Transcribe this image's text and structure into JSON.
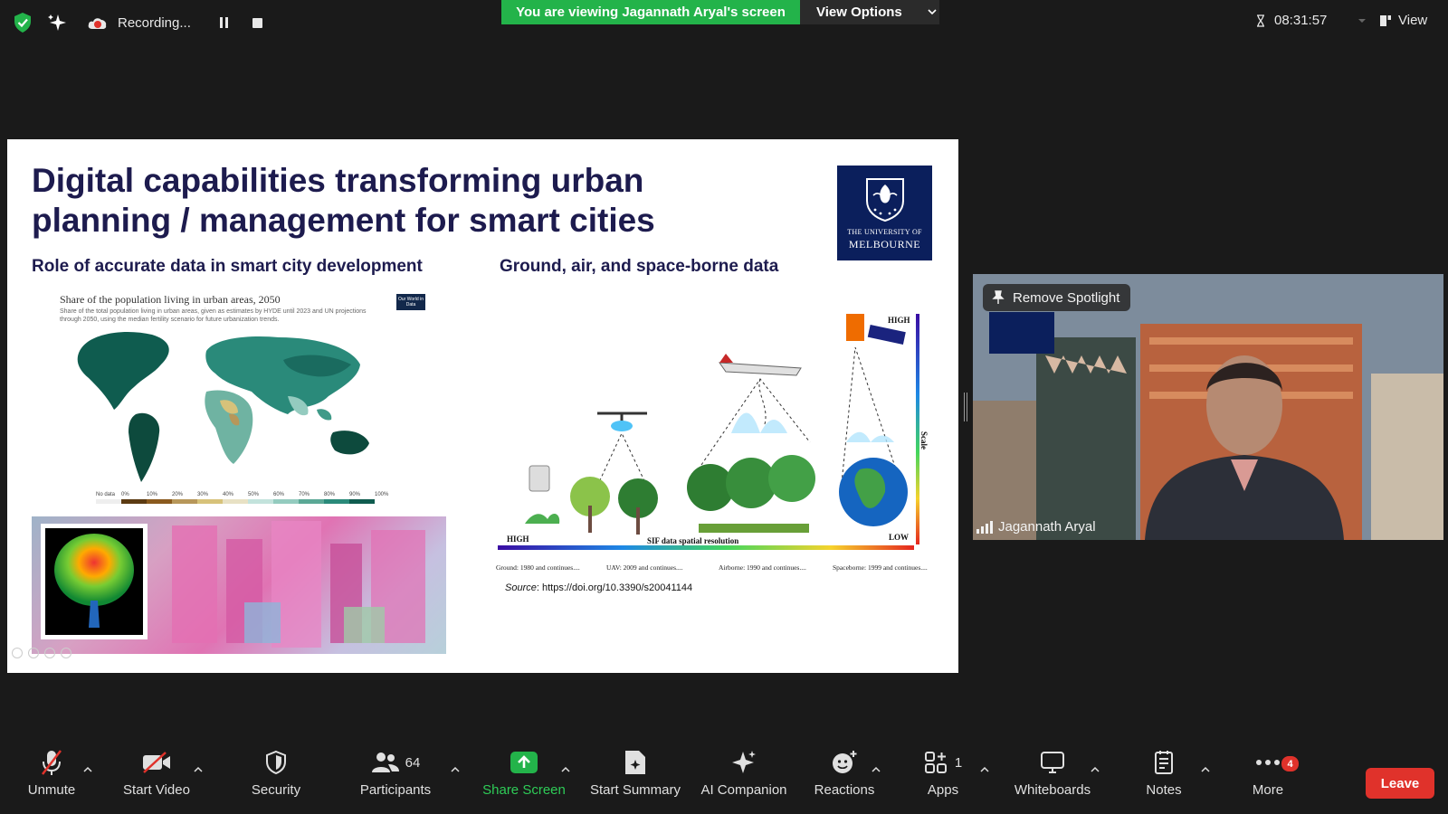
{
  "topbar": {
    "recording_label": "Recording...",
    "viewing_banner": "You are viewing Jagannath Aryal's screen",
    "view_options_label": "View Options",
    "timer": "08:31:57",
    "view_label": "View"
  },
  "slide": {
    "title_line1": "Digital capabilities transforming urban",
    "title_line2": "planning / management for smart cities",
    "logo_line1": "THE UNIVERSITY OF",
    "logo_line2": "MELBOURNE",
    "subtitle_left": "Role of accurate data in smart city development",
    "subtitle_right": "Ground, air, and space-borne data",
    "map": {
      "title": "Share of the population living in urban areas, 2050",
      "description": "Share of the total population living in urban areas, given as estimates by HYDE until 2023 and UN projections through 2050, using the median fertility scenario for future urbanization trends.",
      "badge": "Our World in Data",
      "legend": [
        "No data",
        "0%",
        "10%",
        "20%",
        "30%",
        "40%",
        "50%",
        "60%",
        "70%",
        "80%",
        "90%",
        "100%"
      ]
    },
    "sif": {
      "high_left": "HIGH",
      "high_top": "HIGH",
      "low": "LOW",
      "scale": "Scale",
      "resolution": "SIF data spatial resolution",
      "platforms": [
        "Ground: 1980 and continues....",
        "UAV: 2009 and continues....",
        "Airborne: 1990 and continues....",
        "Spaceborne: 1999 and continues...."
      ]
    },
    "source_label": "Source",
    "source_text": ": https://doi.org/10.3390/s20041144"
  },
  "video": {
    "remove_spotlight": "Remove Spotlight",
    "participant_name": "Jagannath Aryal"
  },
  "toolbar": {
    "unmute": "Unmute",
    "start_video": "Start Video",
    "security": "Security",
    "participants": "Participants",
    "participants_count": "64",
    "share_screen": "Share Screen",
    "start_summary": "Start Summary",
    "ai_companion": "AI Companion",
    "reactions": "Reactions",
    "apps": "Apps",
    "apps_count": "1",
    "whiteboards": "Whiteboards",
    "notes": "Notes",
    "more": "More",
    "more_badge": "4",
    "leave": "Leave"
  },
  "colors": {
    "share_green": "#23b34a",
    "leave_red": "#e0322b",
    "slide_navy": "#1d1b4e",
    "melbourne_blue": "#0b1f5c"
  }
}
